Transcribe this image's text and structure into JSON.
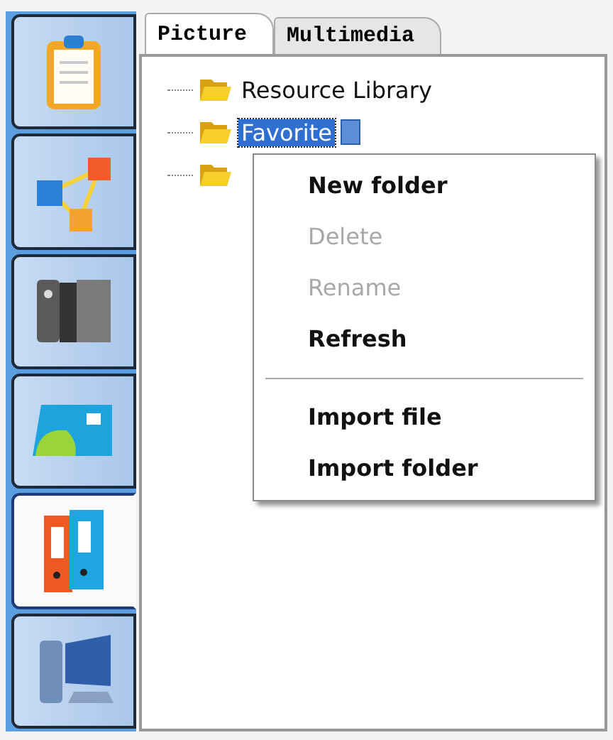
{
  "sidebar": {
    "items": [
      {
        "kind": "clipboard",
        "selected": false
      },
      {
        "kind": "nodes",
        "selected": false
      },
      {
        "kind": "books",
        "selected": false
      },
      {
        "kind": "card",
        "selected": false
      },
      {
        "kind": "binders",
        "selected": true
      },
      {
        "kind": "computer",
        "selected": false
      }
    ]
  },
  "tabs": [
    {
      "label": "Picture",
      "selected": true
    },
    {
      "label": "Multimedia",
      "selected": false
    }
  ],
  "tree": {
    "nodes": [
      {
        "label": "Resource Library",
        "selected": false
      },
      {
        "label": "Favorite",
        "selected": true
      },
      {
        "selected": false
      }
    ]
  },
  "context_menu": {
    "items": [
      {
        "kind": "item",
        "label": "New folder",
        "disabled": false
      },
      {
        "kind": "item",
        "label": "Delete",
        "disabled": true
      },
      {
        "kind": "item",
        "label": "Rename",
        "disabled": true
      },
      {
        "kind": "item",
        "label": "Refresh",
        "disabled": false
      },
      {
        "kind": "separator"
      },
      {
        "kind": "item",
        "label": "Import file",
        "disabled": false
      },
      {
        "kind": "item",
        "label": "Import folder",
        "disabled": false
      }
    ]
  }
}
